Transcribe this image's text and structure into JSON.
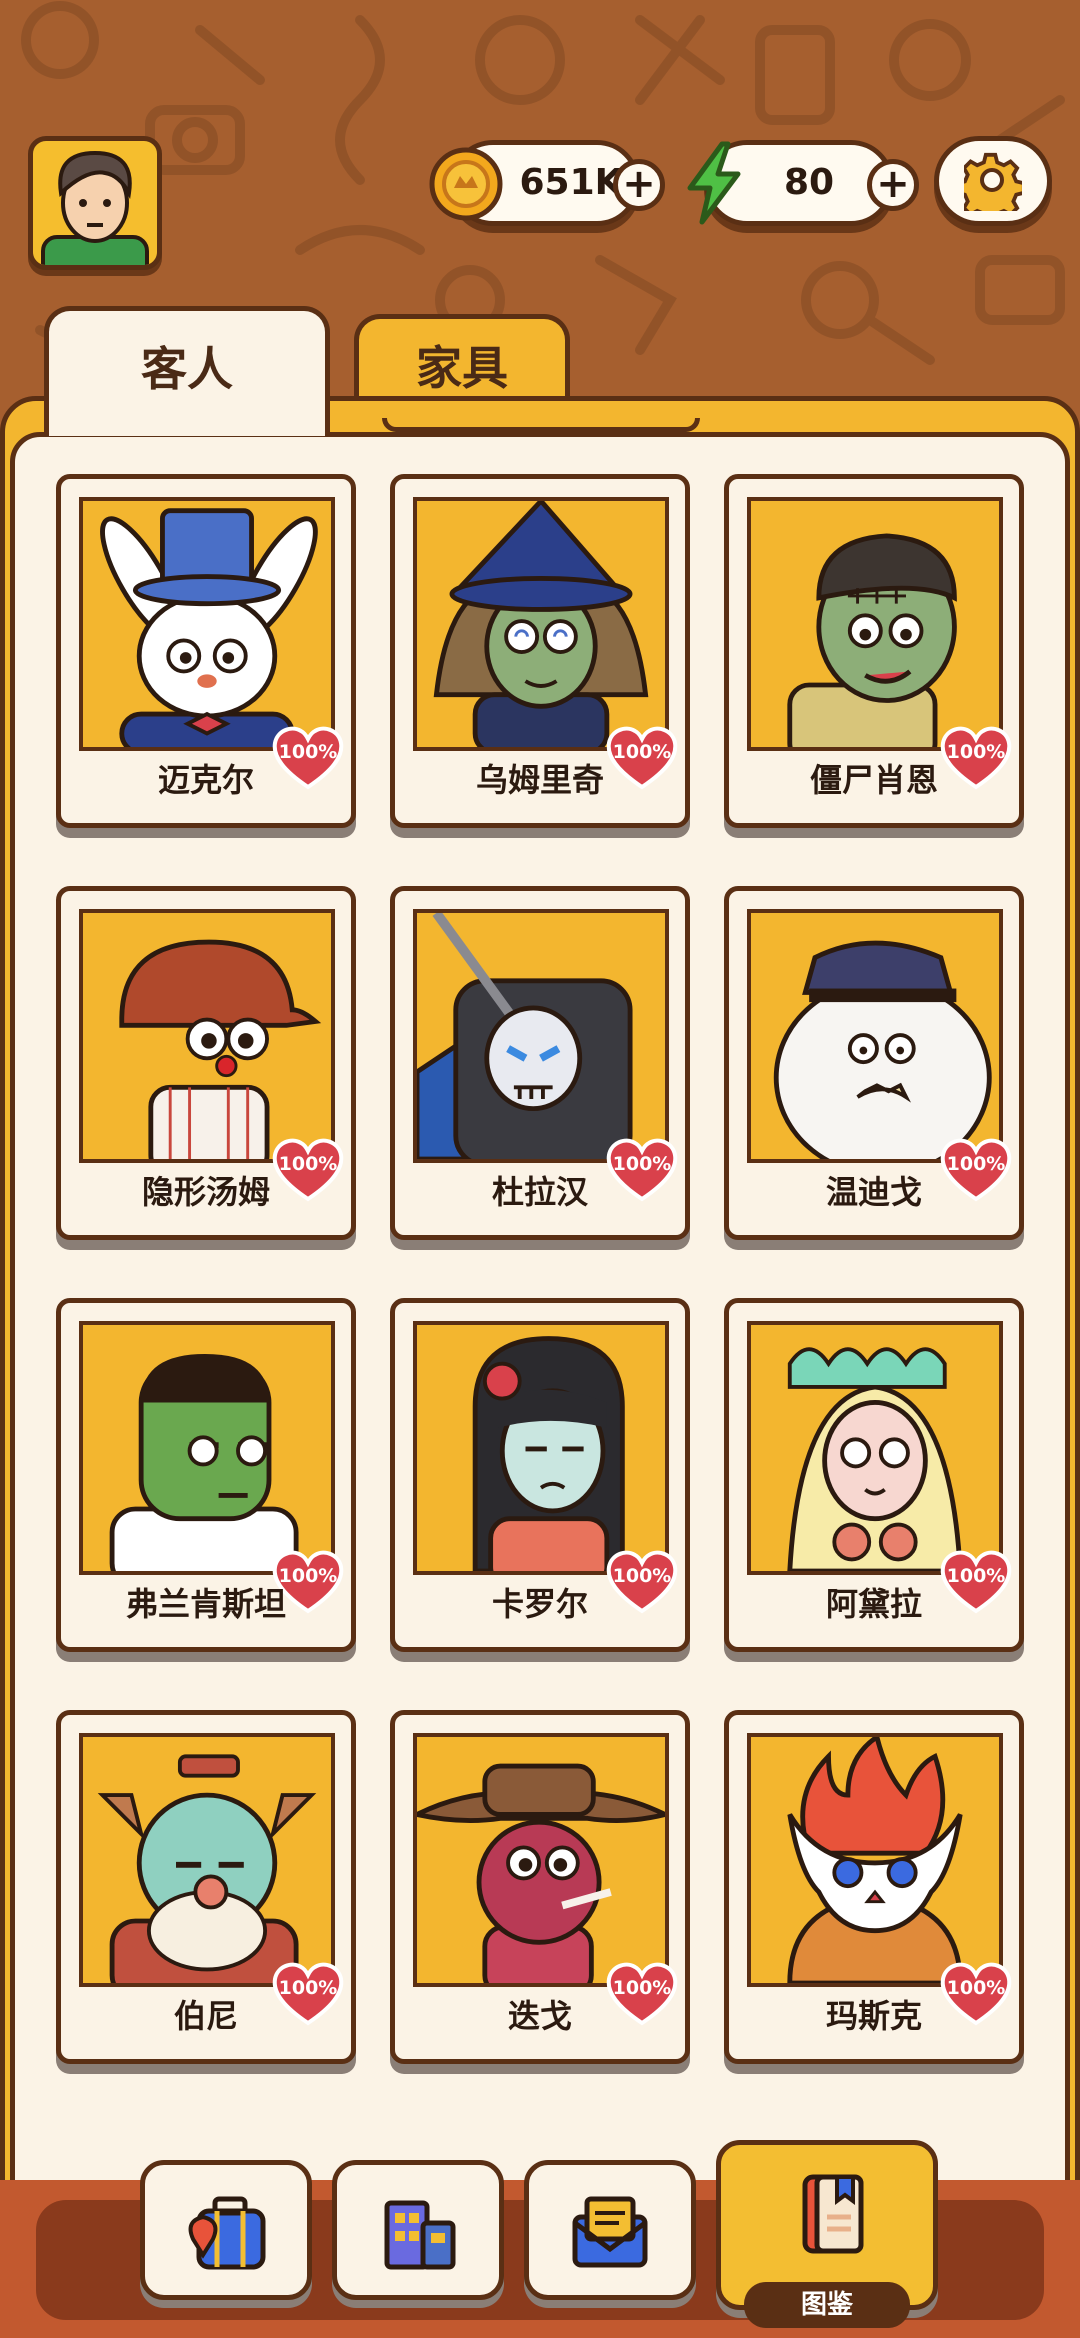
{
  "header": {
    "avatar_icon": "player-avatar",
    "coins": {
      "icon": "coin-icon",
      "value": "651K",
      "plus_label": "+"
    },
    "energy": {
      "icon": "lightning-icon",
      "value": "80",
      "plus_label": "+"
    },
    "settings_icon": "gear-icon"
  },
  "tabs": [
    {
      "label": "客人",
      "active": true
    },
    {
      "label": "家具",
      "active": false
    }
  ],
  "guests": [
    {
      "name": "迈克尔",
      "percent": "100%",
      "portrait": "rabbit-magician"
    },
    {
      "name": "乌姆里奇",
      "percent": "100%",
      "portrait": "witch"
    },
    {
      "name": "僵尸肖恩",
      "percent": "100%",
      "portrait": "zombie"
    },
    {
      "name": "隐形汤姆",
      "percent": "100%",
      "portrait": "invisible-baseball-player"
    },
    {
      "name": "杜拉汉",
      "percent": "100%",
      "portrait": "headless-knight"
    },
    {
      "name": "温迪戈",
      "percent": "100%",
      "portrait": "yeti-captain"
    },
    {
      "name": "弗兰肯斯坦",
      "percent": "100%",
      "portrait": "frankenstein"
    },
    {
      "name": "卡罗尔",
      "percent": "100%",
      "portrait": "ghost-girl"
    },
    {
      "name": "阿黛拉",
      "percent": "100%",
      "portrait": "mermaid"
    },
    {
      "name": "伯尼",
      "percent": "100%",
      "portrait": "old-goblin"
    },
    {
      "name": "迭戈",
      "percent": "100%",
      "portrait": "cowboy-lizard"
    },
    {
      "name": "玛斯克",
      "percent": "100%",
      "portrait": "fire-mask"
    }
  ],
  "bottom_nav": [
    {
      "icon": "suitcase-icon",
      "label": ""
    },
    {
      "icon": "building-icon",
      "label": ""
    },
    {
      "icon": "mail-icon",
      "label": ""
    },
    {
      "icon": "book-icon",
      "label": "图鉴",
      "active": true
    }
  ],
  "colors": {
    "background": "#a65f2f",
    "panel": "#f3b62f",
    "card": "#fbf3e6",
    "outline": "#5a2f14",
    "heart": "#d9414b"
  }
}
